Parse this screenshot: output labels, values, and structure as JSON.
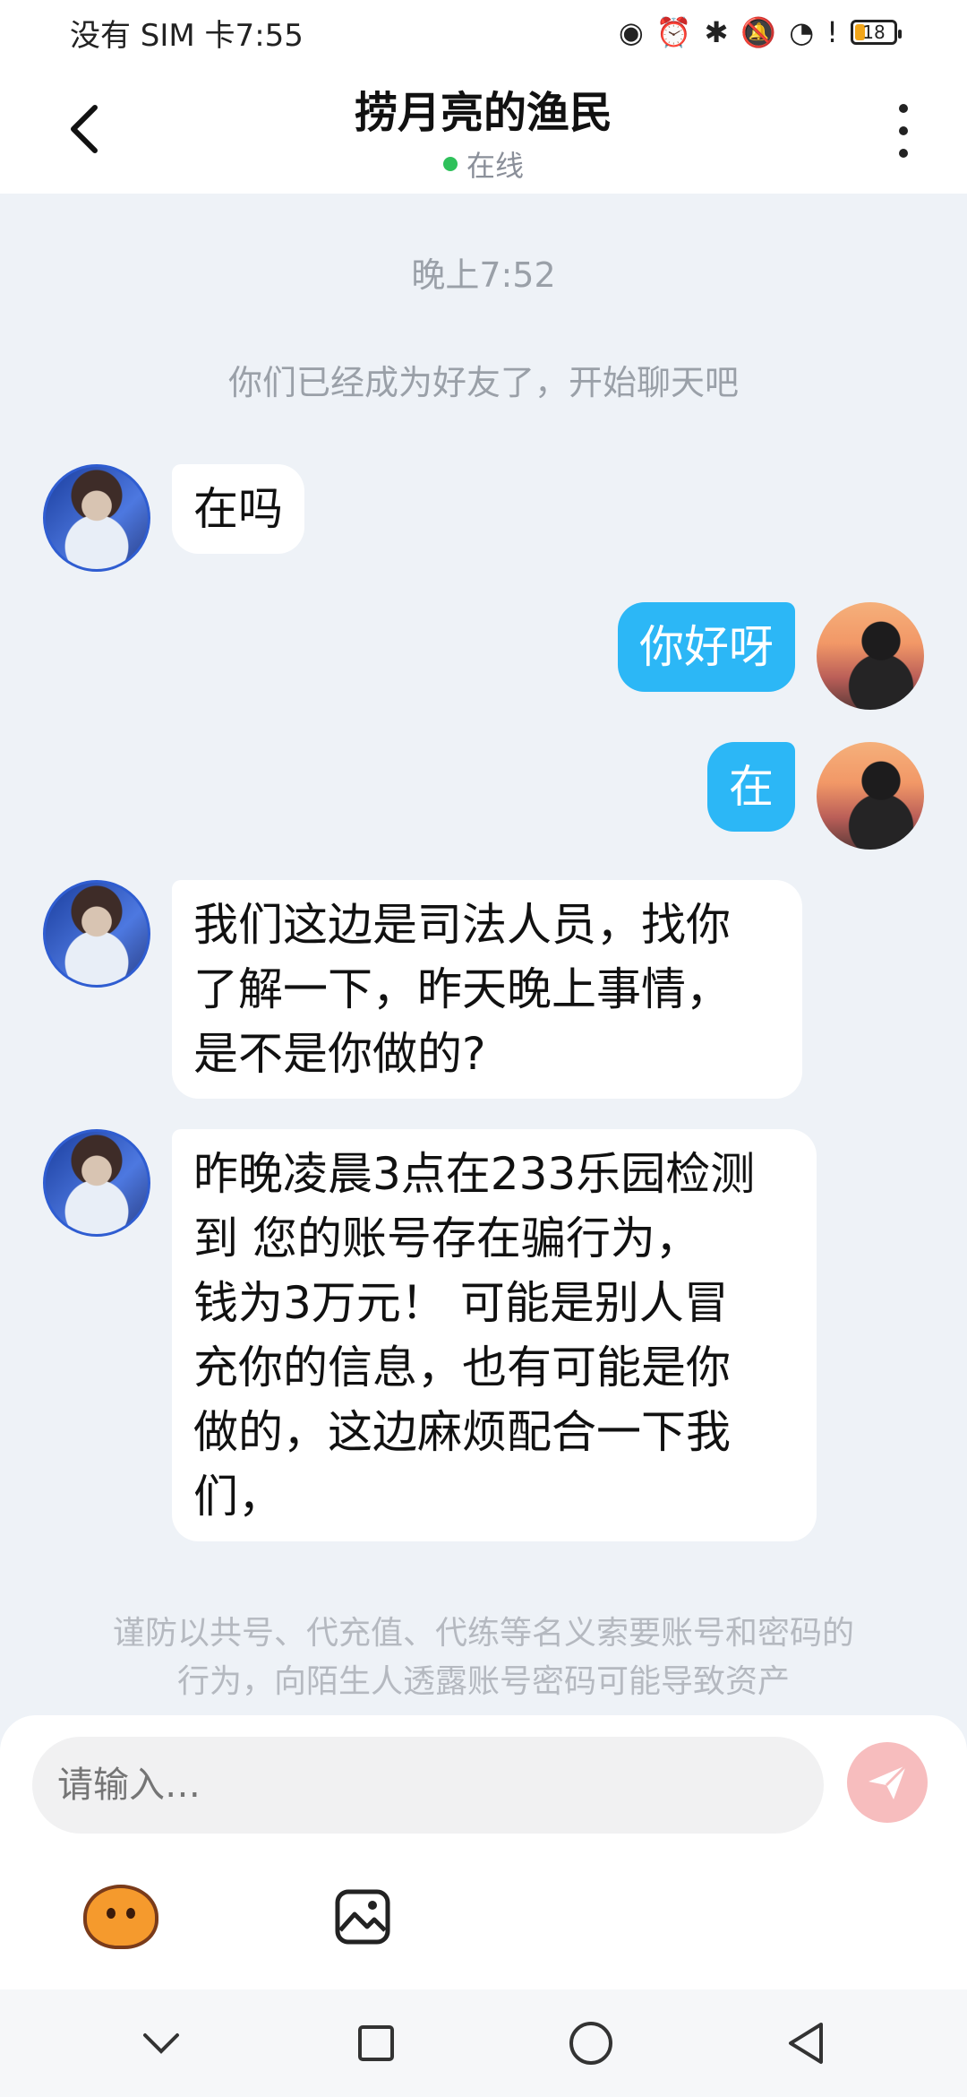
{
  "status_bar": {
    "carrier_time": "没有 SIM 卡7:55",
    "battery_level": "18",
    "icons": [
      "eye-icon",
      "alarm-icon",
      "bluetooth-icon",
      "mute-bell-icon",
      "wifi-icon",
      "warning-icon",
      "battery-icon"
    ]
  },
  "header": {
    "title": "捞月亮的渔民",
    "status": "在线"
  },
  "chat": {
    "time_label": "晚上7:52",
    "system_message": "你们已经成为好友了，开始聊天吧",
    "messages": [
      {
        "side": "left",
        "text": "在吗"
      },
      {
        "side": "right",
        "text": "你好呀"
      },
      {
        "side": "right",
        "text": "在"
      },
      {
        "side": "left",
        "text": "我们这边是司法人员，找你\n了解一下，昨天晚上事情，\n是不是你做的?"
      },
      {
        "side": "left",
        "text": "昨晚凌晨3点在233乐园检测\n到 您的账号存在骗行为，\n钱为3万元！ 可能是别人冒\n充你的信息，也有可能是你\n做的，这边麻烦配合一下我\n们，"
      }
    ],
    "notice": "谨防以共号、代充值、代练等名义索要账号和密码的行为，向陌生人透露账号密码可能导致资产"
  },
  "composer": {
    "placeholder": "请输入…",
    "icons": [
      "mascot-icon",
      "image-icon",
      "send-icon"
    ]
  },
  "navbar": {
    "icons": [
      "chevron-down-icon",
      "recent-apps-icon",
      "home-icon",
      "back-icon"
    ]
  },
  "colors": {
    "accent_bubble": "#2cb7f6",
    "online_dot": "#2fc15b",
    "send_button": "#f7bdbe"
  }
}
